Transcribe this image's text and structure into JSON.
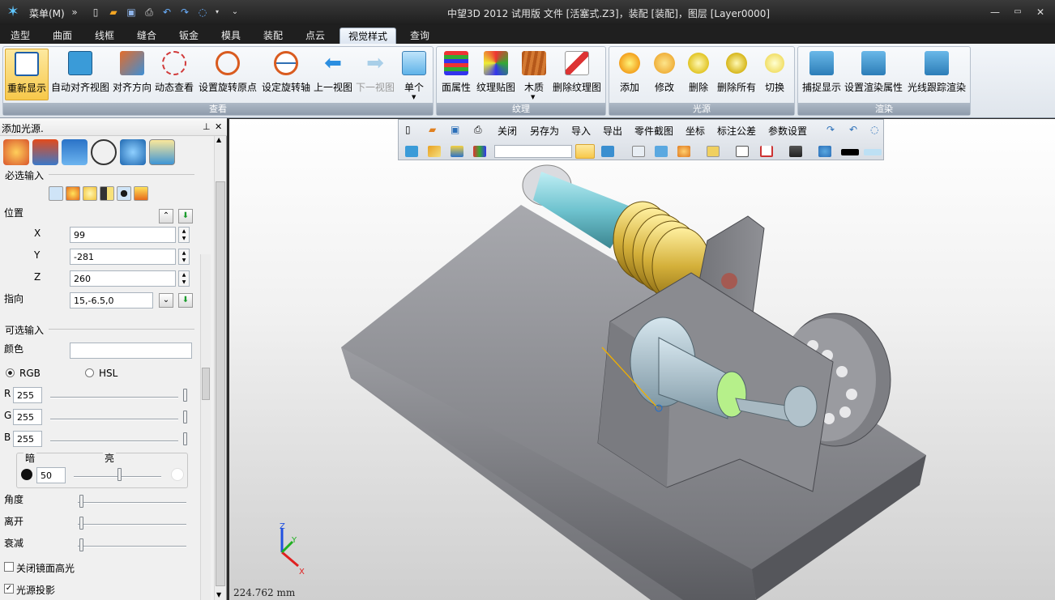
{
  "titlebar": {
    "menu_label": "菜单(M)",
    "title": "中望3D 2012 试用版        文件 [活塞式.Z3]，装配 [装配]，图层 [Layer0000]"
  },
  "tabs": [
    "造型",
    "曲面",
    "线框",
    "缝合",
    "钣金",
    "模具",
    "装配",
    "点云",
    "视觉样式",
    "查询"
  ],
  "active_tab": "视觉样式",
  "ribbon": {
    "groups": {
      "view": "查看",
      "texture": "纹理",
      "light": "光源",
      "render": "渲染"
    },
    "view_buttons": [
      "重新显示",
      "自动对齐视图",
      "对齐方向",
      "动态查看",
      "设置旋转原点",
      "设定旋转轴",
      "上一视图",
      "下一视图",
      "单个"
    ],
    "texture_buttons": [
      "面属性",
      "纹理贴图",
      "木质",
      "删除纹理图"
    ],
    "light_buttons": [
      "添加",
      "修改",
      "删除",
      "删除所有",
      "切换"
    ],
    "render_buttons": [
      "捕捉显示",
      "设置渲染属性",
      "光线跟踪渲染"
    ]
  },
  "panel": {
    "title": "添加光源.",
    "required": "必选输入",
    "position_label": "位置",
    "x_label": "X",
    "x_value": "99",
    "y_label": "Y",
    "y_value": "-281",
    "z_label": "Z",
    "z_value": "260",
    "direction_label": "指向",
    "direction_value": "15,-6.5,0",
    "optional": "可选输入",
    "color_label": "颜色",
    "rgb_label": "RGB",
    "hsl_label": "HSL",
    "r_label": "R",
    "r_value": "255",
    "g_label": "G",
    "g_value": "255",
    "b_label": "B",
    "b_value": "255",
    "dark_label": "暗",
    "bright_label": "亮",
    "intensity_value": "50",
    "angle_label": "角度",
    "distance_label": "离开",
    "falloff_label": "衰减",
    "close_specular_label": "关闭镜面高光",
    "shadow_label": "光源投影"
  },
  "float_toolbar": {
    "items": [
      "关闭",
      "另存为",
      "导入",
      "导出",
      "零件截图",
      "坐标",
      "标注公差",
      "参数设置"
    ]
  },
  "status": {
    "scale": "224.762 mm"
  },
  "axis": {
    "x": "X",
    "y": "Y",
    "z": "Z"
  }
}
